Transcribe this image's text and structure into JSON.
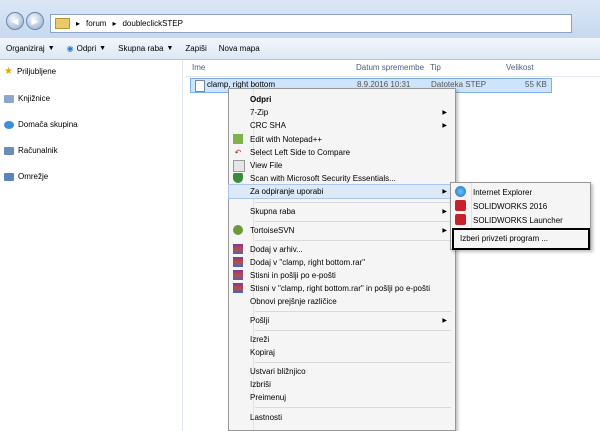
{
  "address": {
    "crumbs": [
      "forum",
      "doubleclickSTEP"
    ],
    "sep": "▸"
  },
  "toolbar": {
    "organize": "Organiziraj",
    "open": "Odpri",
    "share": "Skupna raba",
    "burn": "Zapiši",
    "new_folder": "Nova mapa"
  },
  "nav": {
    "favorites": "Priljubljene",
    "libraries": "Knjižnice",
    "homegroup": "Domača skupina",
    "computer": "Računalnik",
    "network": "Omrežje"
  },
  "columns": {
    "name": "Ime",
    "date": "Datum spremembe",
    "type": "Tip",
    "size": "Velikost"
  },
  "file": {
    "name": "clamp, right bottom",
    "date": "8.9.2016 10:31",
    "type": "Datoteka STEP",
    "size": "55 KB"
  },
  "menu": {
    "open": "Odpri",
    "zip": "7-Zip",
    "crc": "CRC SHA",
    "notepad": "Edit with Notepad++",
    "compare": "Select Left Side to Compare",
    "view": "View File",
    "scan": "Scan with Microsoft Security Essentials...",
    "openwith": "Za odpiranje uporabi",
    "share": "Skupna raba",
    "svn": "TortoiseSVN",
    "add_archive": "Dodaj v arhiv...",
    "add_rar": "Dodaj v \"clamp, right bottom.rar\"",
    "zip_email": "Stisni in pošlji po e-pošti",
    "zip_rar_email": "Stisni v \"clamp, right bottom.rar\" in pošlji po e-pošti",
    "restore": "Obnovi prejšnje različice",
    "sendto": "Pošlji",
    "cut": "Izreži",
    "copy": "Kopiraj",
    "shortcut": "Ustvari bližnjico",
    "delete": "Izbriši",
    "rename": "Preimenuj",
    "properties": "Lastnosti"
  },
  "submenu": {
    "ie": "Internet Explorer",
    "sw2016": "SOLIDWORKS 2016",
    "swlauncher": "SOLIDWORKS Launcher",
    "choose": "Izberi privzeti program ..."
  }
}
